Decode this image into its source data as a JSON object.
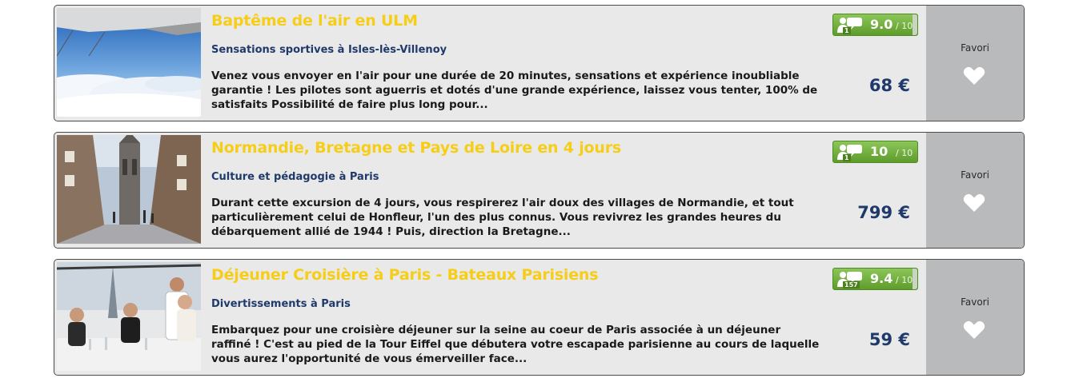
{
  "listings": [
    {
      "title": "Baptême de l'air en ULM",
      "subtitle": "Sensations sportives à Isles-lès-Villenoy",
      "description": "Venez vous envoyer en l'air pour une durée de 20 minutes, sensations et expérience inoubliable garantie ! Les pilotes sont aguerris et dotés d'une grande expérience, laissez vous tenter, 100% de satisfaits Possibilité de faire plus long pour...",
      "rating_score": "9.0",
      "rating_outof": "/ 10",
      "review_count": "1",
      "price": "68 €",
      "favorite_label": "Favori",
      "image_icon": "ulm-sky-clouds-photo"
    },
    {
      "title": "Normandie, Bretagne et Pays de Loire en 4 jours",
      "subtitle": "Culture et pédagogie à Paris",
      "description": "Durant cette excursion de 4 jours, vous respirerez l'air doux des villages de Normandie, et tout particulièrement celui de Honfleur, l'un des plus connus. Vous revivrez les grandes heures du débarquement allié de 1944 ! Puis, direction la Bretagne...",
      "rating_score": "10",
      "rating_outof": "/ 10",
      "review_count": "1",
      "price": "799 €",
      "favorite_label": "Favori",
      "image_icon": "normandy-street-cathedral-photo"
    },
    {
      "title": "Déjeuner Croisière à Paris - Bateaux Parisiens",
      "subtitle": "Divertissements à Paris",
      "description": "Embarquez pour une croisière déjeuner sur la seine au coeur de Paris associée à un déjeuner raffiné ! C'est au pied de la Tour Eiffel que débutera votre escapade parisienne au cours de laquelle vous aurez l'opportunité de vous émerveiller face...",
      "rating_score": "9.4",
      "rating_outof": "/ 10",
      "review_count": "157",
      "price": "59 €",
      "favorite_label": "Favori",
      "image_icon": "seine-cruise-lunch-photo"
    }
  ],
  "colors": {
    "title": "#f6cd17",
    "subtitle": "#1f3a6a",
    "price": "#1f3a6a",
    "rating_green": "#6aa936",
    "card_bg": "#e9e9e9",
    "favorite_bg": "#b9babc"
  }
}
